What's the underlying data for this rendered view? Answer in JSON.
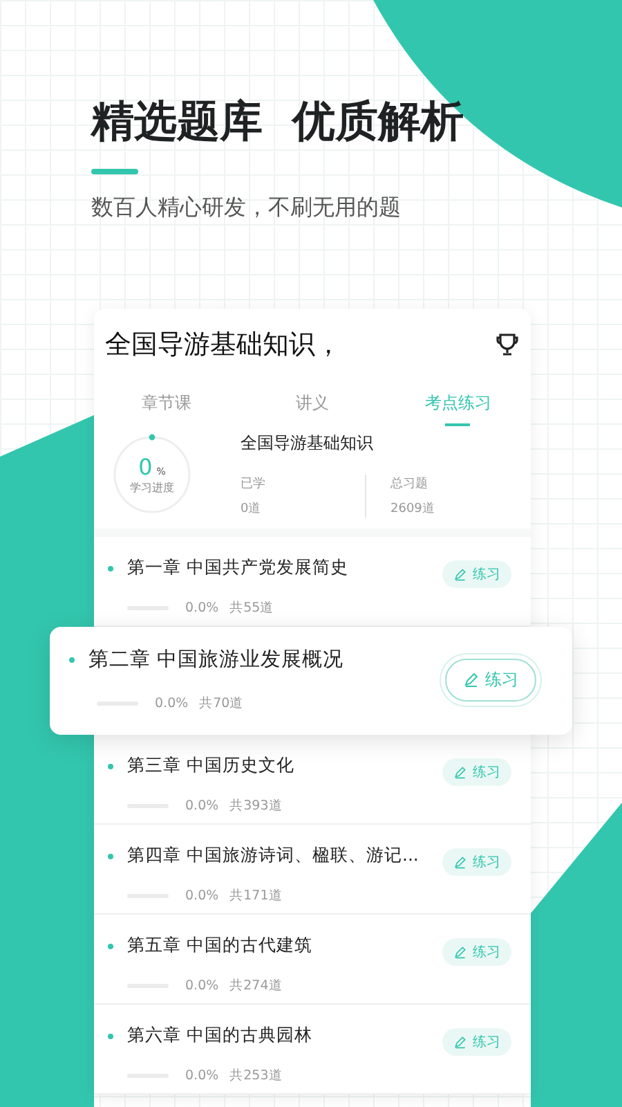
{
  "headline": "精选题库  优质解析",
  "subtitle": "数百人精心研发，不刷无用的题",
  "card": {
    "title": "全国导游基础知识，",
    "tabs": [
      {
        "label": "章节课",
        "selected": false
      },
      {
        "label": "讲义",
        "selected": false
      },
      {
        "label": "考点练习",
        "selected": true
      }
    ],
    "summary": {
      "percent": "0",
      "percent_unit": "%",
      "progress_label": "学习进度",
      "level": 0,
      "name": "全国导游基础知识",
      "stats": [
        {
          "label": "已学",
          "value": "0道"
        },
        {
          "label": "总习题",
          "value": "2609道"
        }
      ]
    },
    "chapters": [
      {
        "title": "第一章 中国共产党发展简史",
        "percent": "0.0%",
        "count": "共55道",
        "highlighted": false,
        "action": "练习"
      },
      {
        "title": "第二章 中国旅游业发展概况",
        "percent": "0.0%",
        "count": "共70道",
        "highlighted": true,
        "action": "练习"
      },
      {
        "title": "第三章 中国历史文化",
        "percent": "0.0%",
        "count": "共393道",
        "highlighted": false,
        "action": "练习"
      },
      {
        "title": "第四章 中国旅游诗词、楹联、游记...",
        "percent": "0.0%",
        "count": "共171道",
        "highlighted": false,
        "action": "练习"
      },
      {
        "title": "第五章 中国的古代建筑",
        "percent": "0.0%",
        "count": "共274道",
        "highlighted": false,
        "action": "练习"
      },
      {
        "title": "第六章 中国的古典园林",
        "percent": "0.0%",
        "count": "共253道",
        "highlighted": false,
        "action": "练习"
      }
    ]
  }
}
